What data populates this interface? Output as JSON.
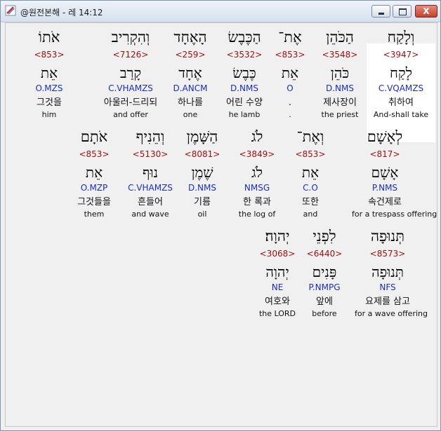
{
  "window": {
    "title": "@원전본해 - 레 14:12",
    "close_glyph": "X"
  },
  "words": [
    {
      "hebrew": "וְלָקַח",
      "strongs": "<3947>",
      "lemma": "לָקַח",
      "morph": "C.VQAMZS",
      "korean": "취하여",
      "english": "And-shall take"
    },
    {
      "hebrew": "הַכֹּהֵן",
      "strongs": "<3548>",
      "lemma": "כֹּהֵן",
      "morph": "D.NMS",
      "korean": "제사장이",
      "english": "the priest"
    },
    {
      "hebrew": "אֶת־",
      "strongs": "<853>",
      "lemma": "אֵת",
      "morph": "O",
      "korean": ".",
      "english": "."
    },
    {
      "hebrew": "הַכֶּבֶשׂ",
      "strongs": "<3532>",
      "lemma": "כֶּבֶשׂ",
      "morph": "D.NMS",
      "korean": "어린 수양",
      "english": "he lamb"
    },
    {
      "hebrew": "הָאֶחָד",
      "strongs": "<259>",
      "lemma": "אֶחָד",
      "morph": "D.ANCM",
      "korean": "하나를",
      "english": "one"
    },
    {
      "hebrew": "וְהִקְרִיב",
      "strongs": "<7126>",
      "lemma": "קָרַב",
      "morph": "C.VHAMZS",
      "korean": "아울러-드리되",
      "english": "and offer"
    },
    {
      "hebrew": "אֹתוֹ",
      "strongs": "<853>",
      "lemma": "אֵת",
      "morph": "O.MZS",
      "korean": "그것을",
      "english": "him"
    },
    {
      "hebrew": "לְאָשָׁם",
      "strongs": "<817>",
      "lemma": "אָשָׁם",
      "morph": "P.NMS",
      "korean": "속건제로",
      "english": "for a trespass offering"
    },
    {
      "hebrew": "וְאֶת־",
      "strongs": "<853>",
      "lemma": "אֵת",
      "morph": "C.O",
      "korean": "또한",
      "english": "and"
    },
    {
      "hebrew": "לֹג",
      "strongs": "<3849>",
      "lemma": "לֹג",
      "morph": "NMSG",
      "korean": "한 록과",
      "english": "the log of"
    },
    {
      "hebrew": "הַשָּׁמֶן",
      "strongs": "<8081>",
      "lemma": "שֶׁמֶן",
      "morph": "D.NMS",
      "korean": "기름",
      "english": "oil"
    },
    {
      "hebrew": "וְהֵנִיף",
      "strongs": "<5130>",
      "lemma": "נוּף",
      "morph": "C.VHAMZS",
      "korean": "흔들어",
      "english": "and wave"
    },
    {
      "hebrew": "אֹתָם",
      "strongs": "<853>",
      "lemma": "אֵת",
      "morph": "O.MZP",
      "korean": "그것들을",
      "english": "them"
    },
    {
      "hebrew": "תְּנוּפָה",
      "strongs": "<8573>",
      "lemma": "תְּנוּפָה",
      "morph": "NFS",
      "korean": "요제를 삼고",
      "english": "for a wave offering"
    },
    {
      "hebrew": "לִפְנֵי",
      "strongs": "<6440>",
      "lemma": "פָּנִים",
      "morph": "P.NMPG",
      "korean": "앞에",
      "english": "before"
    },
    {
      "hebrew": "יְהוָה׃",
      "strongs": "<3068>",
      "lemma": "יְהוָה",
      "morph": "NE",
      "korean": "여호와",
      "english": "the LORD"
    }
  ],
  "selected_index": 0,
  "colors": {
    "strongs": "#a01010",
    "morph": "#1a2ec0",
    "selection": "#ffffff"
  }
}
